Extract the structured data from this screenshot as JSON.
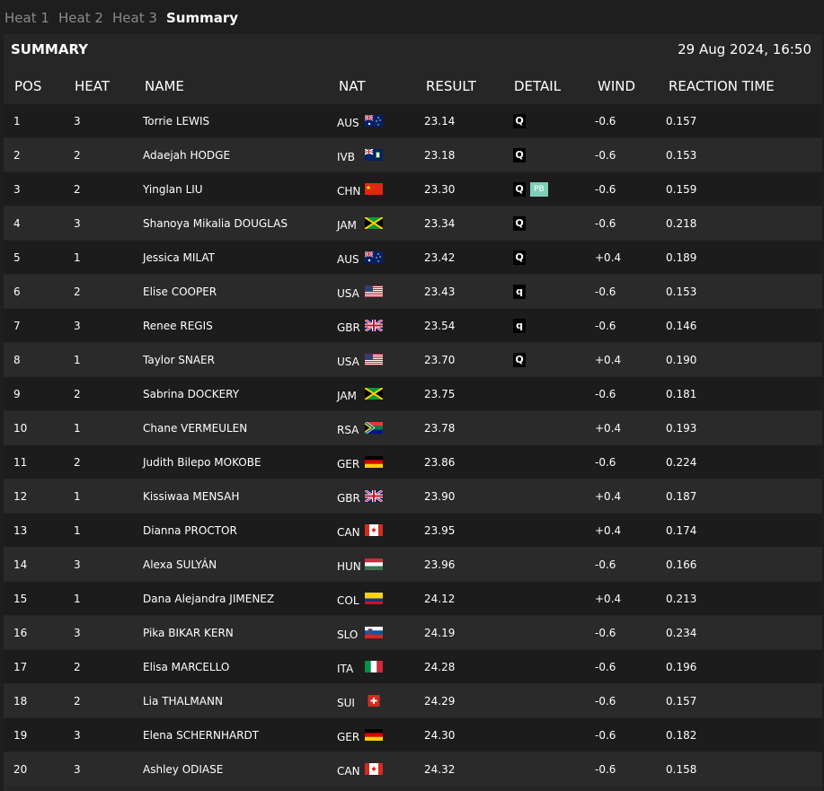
{
  "tabs": [
    "Heat 1",
    "Heat 2",
    "Heat 3",
    "Summary"
  ],
  "active_tab": "Summary",
  "summary": {
    "title": "SUMMARY",
    "datetime": "29 Aug 2024, 16:50"
  },
  "columns": {
    "pos": "POS",
    "heat": "HEAT",
    "name": "NAME",
    "nat": "NAT",
    "result": "RESULT",
    "detail": "DETAIL",
    "wind": "WIND",
    "reaction": "REACTION TIME"
  },
  "rows": [
    {
      "pos": "1",
      "heat": "3",
      "name": "Torrie LEWIS",
      "nat": "AUS",
      "result": "23.14",
      "q": "Q",
      "pb": "",
      "wind": "-0.6",
      "reaction": "0.157"
    },
    {
      "pos": "2",
      "heat": "2",
      "name": "Adaejah HODGE",
      "nat": "IVB",
      "result": "23.18",
      "q": "Q",
      "pb": "",
      "wind": "-0.6",
      "reaction": "0.153"
    },
    {
      "pos": "3",
      "heat": "2",
      "name": "Yinglan LIU",
      "nat": "CHN",
      "result": "23.30",
      "q": "Q",
      "pb": "PB",
      "wind": "-0.6",
      "reaction": "0.159"
    },
    {
      "pos": "4",
      "heat": "3",
      "name": "Shanoya Mikalia DOUGLAS",
      "nat": "JAM",
      "result": "23.34",
      "q": "Q",
      "pb": "",
      "wind": "-0.6",
      "reaction": "0.218"
    },
    {
      "pos": "5",
      "heat": "1",
      "name": "Jessica MILAT",
      "nat": "AUS",
      "result": "23.42",
      "q": "Q",
      "pb": "",
      "wind": "+0.4",
      "reaction": "0.189"
    },
    {
      "pos": "6",
      "heat": "2",
      "name": "Elise COOPER",
      "nat": "USA",
      "result": "23.43",
      "q": "q",
      "pb": "",
      "wind": "-0.6",
      "reaction": "0.153"
    },
    {
      "pos": "7",
      "heat": "3",
      "name": "Renee REGIS",
      "nat": "GBR",
      "result": "23.54",
      "q": "q",
      "pb": "",
      "wind": "-0.6",
      "reaction": "0.146"
    },
    {
      "pos": "8",
      "heat": "1",
      "name": "Taylor SNAER",
      "nat": "USA",
      "result": "23.70",
      "q": "Q",
      "pb": "",
      "wind": "+0.4",
      "reaction": "0.190"
    },
    {
      "pos": "9",
      "heat": "2",
      "name": "Sabrina DOCKERY",
      "nat": "JAM",
      "result": "23.75",
      "q": "",
      "pb": "",
      "wind": "-0.6",
      "reaction": "0.181"
    },
    {
      "pos": "10",
      "heat": "1",
      "name": "Chane VERMEULEN",
      "nat": "RSA",
      "result": "23.78",
      "q": "",
      "pb": "",
      "wind": "+0.4",
      "reaction": "0.193"
    },
    {
      "pos": "11",
      "heat": "2",
      "name": "Judith Bilepo MOKOBE",
      "nat": "GER",
      "result": "23.86",
      "q": "",
      "pb": "",
      "wind": "-0.6",
      "reaction": "0.224"
    },
    {
      "pos": "12",
      "heat": "1",
      "name": "Kissiwaa MENSAH",
      "nat": "GBR",
      "result": "23.90",
      "q": "",
      "pb": "",
      "wind": "+0.4",
      "reaction": "0.187"
    },
    {
      "pos": "13",
      "heat": "1",
      "name": "Dianna PROCTOR",
      "nat": "CAN",
      "result": "23.95",
      "q": "",
      "pb": "",
      "wind": "+0.4",
      "reaction": "0.174"
    },
    {
      "pos": "14",
      "heat": "3",
      "name": "Alexa SULYÁN",
      "nat": "HUN",
      "result": "23.96",
      "q": "",
      "pb": "",
      "wind": "-0.6",
      "reaction": "0.166"
    },
    {
      "pos": "15",
      "heat": "1",
      "name": "Dana Alejandra JIMENEZ",
      "nat": "COL",
      "result": "24.12",
      "q": "",
      "pb": "",
      "wind": "+0.4",
      "reaction": "0.213"
    },
    {
      "pos": "16",
      "heat": "3",
      "name": "Pika BIKAR KERN",
      "nat": "SLO",
      "result": "24.19",
      "q": "",
      "pb": "",
      "wind": "-0.6",
      "reaction": "0.234"
    },
    {
      "pos": "17",
      "heat": "2",
      "name": "Elisa MARCELLO",
      "nat": "ITA",
      "result": "24.28",
      "q": "",
      "pb": "",
      "wind": "-0.6",
      "reaction": "0.196"
    },
    {
      "pos": "18",
      "heat": "2",
      "name": "Lia THALMANN",
      "nat": "SUI",
      "result": "24.29",
      "q": "",
      "pb": "",
      "wind": "-0.6",
      "reaction": "0.157"
    },
    {
      "pos": "19",
      "heat": "3",
      "name": "Elena SCHERNHARDT",
      "nat": "GER",
      "result": "24.30",
      "q": "",
      "pb": "",
      "wind": "-0.6",
      "reaction": "0.182"
    },
    {
      "pos": "20",
      "heat": "3",
      "name": "Ashley ODIASE",
      "nat": "CAN",
      "result": "24.32",
      "q": "",
      "pb": "",
      "wind": "-0.6",
      "reaction": "0.158"
    }
  ],
  "colors": {
    "background": "#1e1e1e",
    "panel": "#262626",
    "row_dark": "#1c1c1c",
    "row_light": "#2a2a2a",
    "tab_inactive": "#8a8a8a",
    "pb_badge": "#7fcfb8"
  }
}
